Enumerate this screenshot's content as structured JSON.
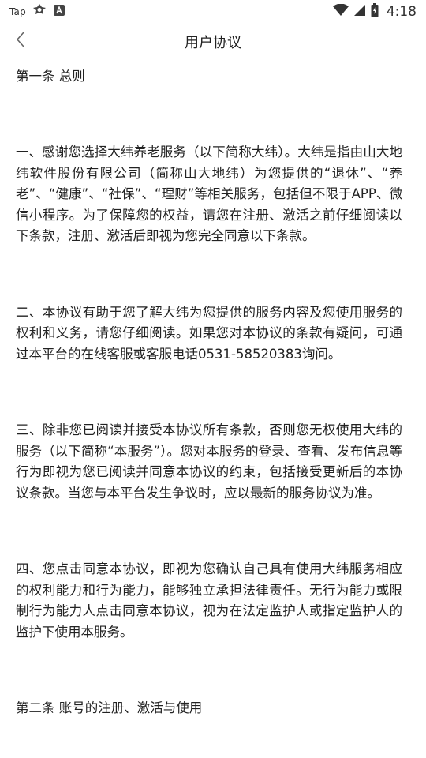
{
  "status_bar": {
    "app_label": "Tap",
    "time": "4:18",
    "icons": [
      "tap-logo-icon",
      "game-icon",
      "notification-a-icon",
      "wifi-icon",
      "signal-icon",
      "battery-icon"
    ]
  },
  "nav": {
    "back_icon": "chevron-left-icon",
    "title": "用户协议"
  },
  "content": {
    "section1_title": "第一条 总则",
    "paragraphs": [
      "一、感谢您选择大纬养老服务（以下简称大纬）。大纬是指由山大地纬软件股份有限公司（简称山大地纬）为您提供的“退休”、“养老”、“健康”、“社保”、“理财”等相关服务，包括但不限于APP、微信小程序。为了保障您的权益，请您在注册、激活之前仔细阅读以下条款，注册、激活后即视为您完全同意以下条款。",
      "二、本协议有助于您了解大纬为您提供的服务内容及您使用服务的权利和义务，请您仔细阅读。如果您对本协议的条款有疑问，可通过本平台的在线客服或客服电话0531-58520383询问。",
      "三、除非您已阅读并接受本协议所有条款，否则您无权使用大纬的服务（以下简称“本服务”）。您对本服务的登录、查看、发布信息等行为即视为您已阅读并同意本协议的约束，包括接受更新后的本协议条款。当您与本平台发生争议时，应以最新的服务协议为准。",
      "四、您点击同意本协议，即视为您确认自己具有使用大纬服务相应的权利能力和行为能力，能够独立承担法律责任。无行为能力或限制行为能力人点击同意本协议，视为在法定监护人或指定监护人的监护下使用本服务。"
    ],
    "section2_title": "第二条 账号的注册、激活与使用"
  }
}
